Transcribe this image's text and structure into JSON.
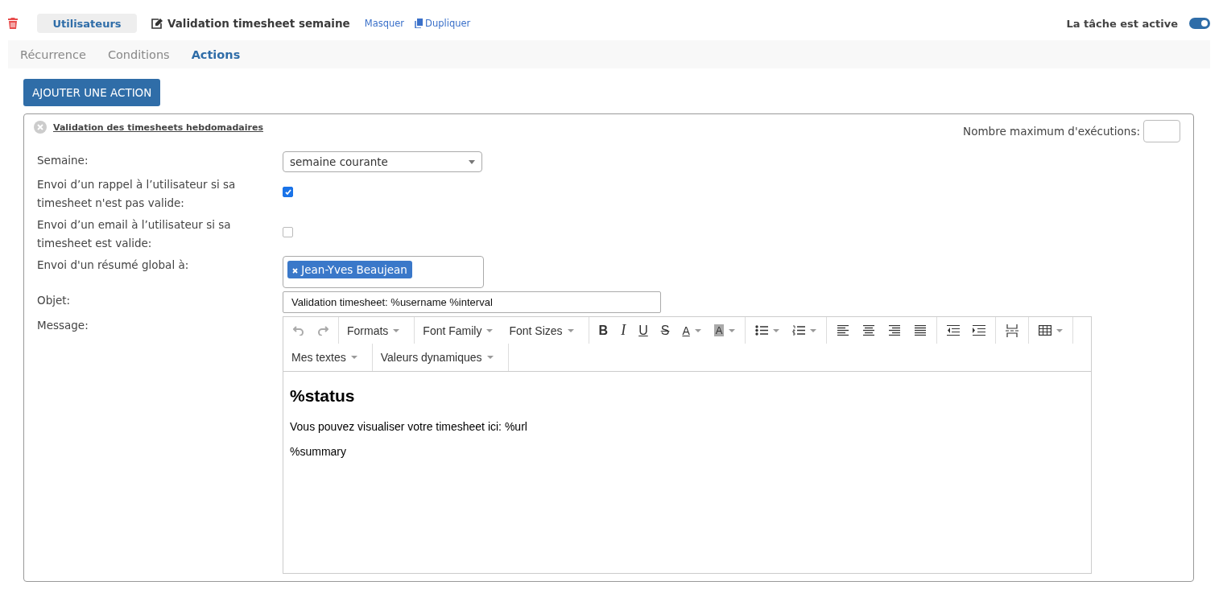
{
  "header": {
    "group": "Utilisateurs",
    "title": "Validation timesheet semaine",
    "links": [
      {
        "label": "Masquer",
        "kind": "hide"
      },
      {
        "label": "Dupliquer",
        "kind": "copy"
      }
    ],
    "active_label": "La tâche est active",
    "active": true
  },
  "tabs": [
    {
      "label": "Récurrence",
      "selected": false
    },
    {
      "label": "Conditions",
      "selected": false
    },
    {
      "label": "Actions",
      "selected": true
    }
  ],
  "add_button": "AJOUTER UNE ACTION",
  "action": {
    "title": "Validation des timesheets hebdomadaires",
    "max_label": "Nombre maximum d'exécutions:",
    "fields": [
      {
        "kind": "select",
        "label": "Semaine:",
        "value": "semaine courante"
      },
      {
        "kind": "checkbox",
        "label": "Envoi d’un rappel à l’utilisateur si sa timesheet n'est pas valide:",
        "checked": true
      },
      {
        "kind": "checkbox",
        "label": "Envoi d’un email à l’utilisateur si sa timesheet est valide:",
        "checked": false
      },
      {
        "kind": "tags",
        "label": "Envoi d'un résumé global à:",
        "tags": [
          "Jean-Yves Beaujean"
        ]
      },
      {
        "kind": "text",
        "label": "Objet:",
        "value": "Validation timesheet: %username %interval"
      },
      {
        "kind": "editor",
        "label": "Message:"
      }
    ],
    "toolbar": [
      [
        [
          {
            "kind": "undo",
            "disabled": true
          },
          {
            "kind": "redo",
            "disabled": true
          }
        ],
        [
          {
            "kind": "menu",
            "label": "Formats",
            "caret": true
          }
        ],
        [
          {
            "kind": "menu",
            "label": "Font Family",
            "caret": true
          },
          {
            "kind": "menu",
            "label": "Font Sizes",
            "caret": true
          }
        ],
        [
          {
            "kind": "bold",
            "label": "B"
          },
          {
            "kind": "italic",
            "label": "I"
          },
          {
            "kind": "underline",
            "label": "U"
          },
          {
            "kind": "strike",
            "label": "S"
          },
          {
            "kind": "forecolor",
            "label": "A",
            "caret": true
          },
          {
            "kind": "backcolor",
            "label": "A",
            "caret": true
          }
        ],
        [
          {
            "kind": "bullist",
            "caret": true
          },
          {
            "kind": "numlist",
            "caret": true
          }
        ],
        [
          {
            "kind": "alignleft"
          },
          {
            "kind": "aligncenter"
          },
          {
            "kind": "alignright"
          },
          {
            "kind": "alignjustify"
          }
        ],
        [
          {
            "kind": "outdent"
          },
          {
            "kind": "indent"
          }
        ],
        [
          {
            "kind": "pagebreak"
          }
        ],
        [
          {
            "kind": "table",
            "caret": true
          }
        ]
      ],
      [
        [
          {
            "kind": "menu",
            "label": "Mes textes",
            "caret": true
          }
        ],
        [
          {
            "kind": "menu",
            "label": "Valeurs dynamiques",
            "caret": true
          }
        ]
      ]
    ],
    "content": [
      {
        "kind": "heading",
        "text": "%status"
      },
      {
        "kind": "paragraph",
        "text": "Vous pouvez visualiser votre timesheet ici: %url"
      },
      {
        "kind": "paragraph",
        "text": "%summary"
      }
    ]
  }
}
